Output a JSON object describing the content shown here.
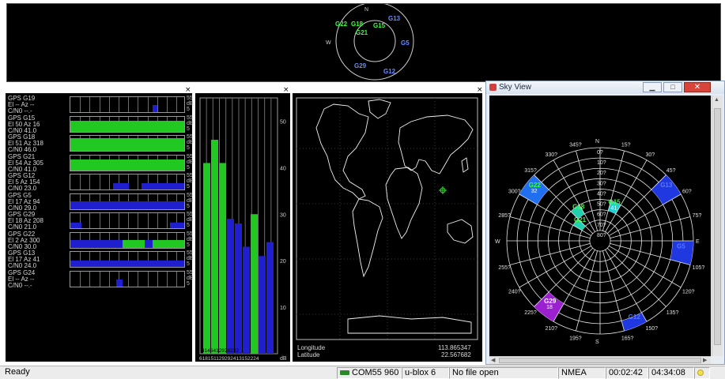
{
  "satellites": [
    {
      "name": "GPS G19",
      "el": "El -- Az --",
      "cn": "C/N0 --.-",
      "strength": 0,
      "color": "#1f1fd0",
      "blocks": [
        [
          104,
          6
        ]
      ]
    },
    {
      "name": "GPS G15",
      "el": "El 50 Az 16",
      "cn": "C/N0 41.0",
      "strength": 41,
      "color": "#22c822",
      "blocks": [
        [
          0,
          146
        ]
      ]
    },
    {
      "name": "GPS G18",
      "el": "El 51 Az 318",
      "cn": "C/N0 46.0",
      "strength": 46,
      "color": "#22c822",
      "blocks": [
        [
          0,
          146
        ]
      ]
    },
    {
      "name": "GPS G21",
      "el": "El 54 Az 305",
      "cn": "C/N0 41.0",
      "strength": 41,
      "color": "#22c822",
      "blocks": [
        [
          0,
          146
        ]
      ]
    },
    {
      "name": "GPS G12",
      "el": "El 5 Az 154",
      "cn": "C/N0 23.0",
      "strength": 23,
      "color": "#1f1fd0",
      "blocks": [
        [
          54,
          20
        ],
        [
          90,
          56
        ]
      ]
    },
    {
      "name": "GPS G5",
      "el": "El 17 Az 94",
      "cn": "C/N0 29.0",
      "strength": 29,
      "color": "#1f1fd0",
      "blocks": [
        [
          0,
          146
        ]
      ]
    },
    {
      "name": "GPS G29",
      "el": "El 18 Az 208",
      "cn": "C/N0 21.0",
      "strength": 21,
      "color": "#1f1fd0",
      "blocks": [
        [
          0,
          14
        ],
        [
          126,
          20
        ]
      ]
    },
    {
      "name": "GPS G22",
      "el": "El 2 Az 300",
      "cn": "C/N0 30.0",
      "strength": 30,
      "color": "#1f1fd0",
      "blocks": [
        [
          0,
          66
        ],
        [
          66,
          28,
          "#22c822"
        ],
        [
          94,
          10
        ],
        [
          104,
          42,
          "#22c822"
        ]
      ]
    },
    {
      "name": "GPS G13",
      "el": "El 17 Az 41",
      "cn": "C/N0 24.0",
      "strength": 24,
      "color": "#1f1fd0",
      "blocks": [
        [
          0,
          146
        ]
      ]
    },
    {
      "name": "GPS G24",
      "el": "El -- Az --",
      "cn": "C/N0 --.-",
      "strength": 0,
      "color": "#1f1fd0",
      "blocks": [
        [
          58,
          8
        ]
      ]
    }
  ],
  "scale_labels": {
    "high": "55",
    "unit": "dB",
    "low": "5"
  },
  "bar_chart": {
    "y_ticks": [
      "50",
      "40",
      "30",
      "20",
      "10"
    ],
    "unit": "dB",
    "bottom_labels_top": "4146412928232",
    "bottom_labels_low": "618151129292413152224",
    "bars": [
      {
        "value": 41,
        "color": "#22c822"
      },
      {
        "value": 46,
        "color": "#22c822"
      },
      {
        "value": 41,
        "color": "#22c822"
      },
      {
        "value": 29,
        "color": "#1f1fd0"
      },
      {
        "value": 28,
        "color": "#1f1fd0"
      },
      {
        "value": 23,
        "color": "#1f1fd0"
      },
      {
        "value": 30,
        "color": "#22c822"
      },
      {
        "value": 21,
        "color": "#1f1fd0"
      },
      {
        "value": 24,
        "color": "#1f1fd0"
      }
    ]
  },
  "world_map": {
    "longitude_label": "Longitude",
    "longitude_value": "113.865347",
    "latitude_label": "Latitude",
    "latitude_value": "22.567682"
  },
  "top_sky": {
    "north": "N",
    "west": "W",
    "sats": [
      {
        "name": "G22",
        "color": "#3cff3c"
      },
      {
        "name": "G18",
        "color": "#3cff3c"
      },
      {
        "name": "G15",
        "color": "#3cff3c"
      },
      {
        "name": "G21",
        "color": "#3cff3c"
      },
      {
        "name": "G13",
        "color": "#6a8cff"
      },
      {
        "name": "G5",
        "color": "#6a8cff"
      },
      {
        "name": "G29",
        "color": "#6a8cff"
      },
      {
        "name": "G12",
        "color": "#6a8cff"
      }
    ]
  },
  "sky_view": {
    "title": "Sky View",
    "azimuth_labels": [
      "N",
      "15?",
      "30?",
      "45?",
      "60?",
      "75?",
      "E",
      "105?",
      "120?",
      "135?",
      "150?",
      "165?",
      "S",
      "195?",
      "210?",
      "225?",
      "240?",
      "255?",
      "W",
      "285?",
      "300?",
      "315?",
      "330?",
      "345?"
    ],
    "elevation_labels": [
      "0?",
      "10?",
      "20?",
      "30?",
      "40?",
      "50?",
      "60?",
      "70?",
      "80?"
    ],
    "sats": [
      {
        "name": "G22",
        "color": "#40ff40",
        "cell": "#1f6ff0",
        "cell_label": "32"
      },
      {
        "name": "G18",
        "color": "#40ff40",
        "cell": "#20d0b0"
      },
      {
        "name": "G15",
        "color": "#40ff40",
        "cell": "#20d0d0",
        "cell_label": "41"
      },
      {
        "name": "G21",
        "color": "#40ff40",
        "cell": "#20d0b0"
      },
      {
        "name": "G13",
        "color": "#5a78ff",
        "cell": "#1f38e0"
      },
      {
        "name": "G5",
        "color": "#5a78ff",
        "cell": "#1f38e0"
      },
      {
        "name": "G29",
        "color": "#ffffff",
        "cell": "#9a20d0",
        "cell_label": "18"
      },
      {
        "name": "G12",
        "color": "#5a78ff",
        "cell": "#1f38e0"
      }
    ]
  },
  "status": {
    "ready": "Ready",
    "port": "COM55 960",
    "receiver": "u-blox 6",
    "file": "No file open",
    "protocol": "NMEA",
    "elapsed": "00:02:42",
    "time": "04:34:08"
  },
  "colors": {
    "gps_green": "#22c822",
    "gps_blue": "#1f1fd0",
    "background": "#000000"
  }
}
